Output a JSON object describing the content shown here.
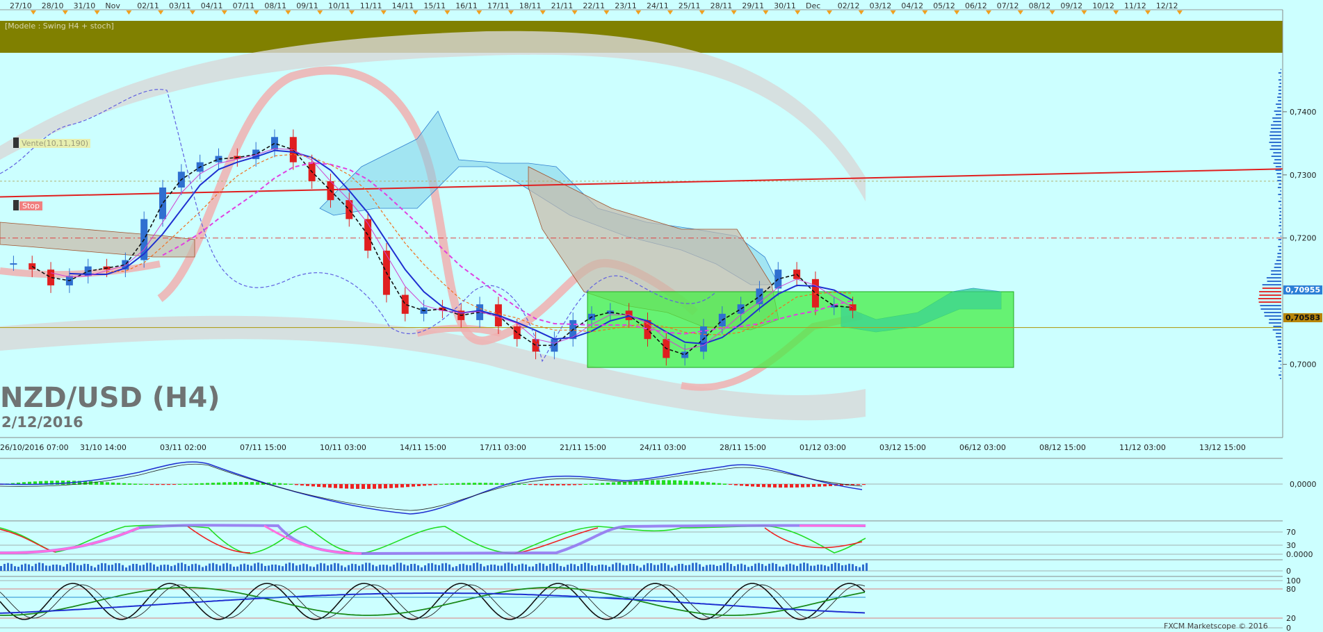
{
  "window": {
    "chart_title": "NZD/USD (H4)",
    "date_text": "2/12/2016",
    "model_label": "[Modele : Swing H4 + stoch]",
    "copyright": "FXCM Marketscope © 2016"
  },
  "tags": {
    "sell": "Vente(10,11,190)",
    "stop": "Stop"
  },
  "price_labels": {
    "current": "0,70955",
    "level": "0,70583"
  },
  "colors": {
    "background": "#ccffff",
    "header_band": "#808000",
    "bull_candle": "#2f6fd0",
    "bear_candle": "#e01f1f",
    "projection_box": "#44ee44",
    "trend_line": "#e01f1f",
    "fib_line": "#b0a020"
  },
  "chart_data": {
    "type": "candlestick",
    "instrument": "NZD/USD",
    "timeframe": "H4",
    "top_date_axis": [
      "27/10",
      "28/10",
      "31/10",
      "Nov",
      "02/11",
      "03/11",
      "04/11",
      "07/11",
      "08/11",
      "09/11",
      "10/11",
      "11/11",
      "14/11",
      "15/11",
      "16/11",
      "17/11",
      "18/11",
      "21/11",
      "22/11",
      "23/11",
      "24/11",
      "25/11",
      "28/11",
      "29/11",
      "30/11",
      "Dec",
      "02/12",
      "03/12",
      "04/12",
      "05/12",
      "06/12",
      "07/12",
      "08/12",
      "09/12",
      "10/12",
      "11/12",
      "12/12"
    ],
    "bottom_time_axis": [
      "26/10/2016 07:00",
      "31/10 14:00",
      "03/11 02:00",
      "07/11 15:00",
      "10/11 03:00",
      "14/11 15:00",
      "17/11 03:00",
      "21/11 15:00",
      "24/11 03:00",
      "28/11 15:00",
      "01/12 03:00",
      "03/12 15:00",
      "06/12 03:00",
      "08/12 15:00",
      "11/12 03:00",
      "13/12 15:00"
    ],
    "price_axis": [
      "0,7400",
      "0,7300",
      "0,7200",
      "0,7000"
    ],
    "price_range": [
      0.6895,
      0.75
    ],
    "close_series": [
      0.716,
      0.715,
      0.7125,
      0.714,
      0.7155,
      0.715,
      0.7165,
      0.723,
      0.728,
      0.7305,
      0.732,
      0.733,
      0.7325,
      0.734,
      0.736,
      0.732,
      0.729,
      0.726,
      0.723,
      0.718,
      0.711,
      0.708,
      0.709,
      0.7085,
      0.707,
      0.7095,
      0.706,
      0.704,
      0.702,
      0.704,
      0.707,
      0.708,
      0.7085,
      0.707,
      0.704,
      0.701,
      0.702,
      0.706,
      0.708,
      0.7095,
      0.712,
      0.715,
      0.7135,
      0.709,
      0.7095,
      0.7085
    ],
    "levels": {
      "resistance_dashed": 0.72,
      "sell_dotted": 0.729,
      "fib_level": 0.70583,
      "current": 0.70955
    },
    "projection_zone": {
      "start_index": 31,
      "end_index": 53,
      "high": 0.7115,
      "low": 0.6995
    },
    "indicators": {
      "macd_zero_label": "0,0000",
      "rsi_levels": [
        "70",
        "30",
        "0.0000"
      ],
      "volume_zero": "0",
      "stochastic_levels": [
        "100",
        "80",
        "20",
        "0"
      ]
    }
  }
}
